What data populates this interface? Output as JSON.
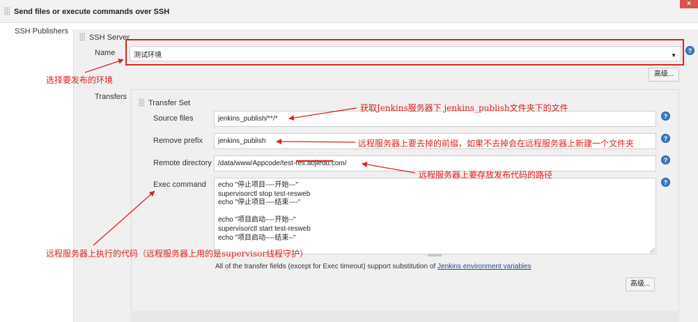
{
  "header": {
    "title": "Send files or execute commands over SSH",
    "close": "×"
  },
  "publishers": {
    "label": "SSH Publishers"
  },
  "server": {
    "section_title": "SSH Server",
    "name_label": "Name",
    "name_value": "测试环境",
    "advanced_button": "高级..."
  },
  "transfers": {
    "label": "Transfers",
    "set_title": "Transfer Set",
    "source_files_label": "Source files",
    "source_files_value": "jenkins_publish/**/*",
    "remove_prefix_label": "Remove prefix",
    "remove_prefix_value": "jenkins_publish",
    "remote_directory_label": "Remote directory",
    "remote_directory_value": "/data/www/Appcode/test-res.aojiedu.com/",
    "exec_command_label": "Exec command",
    "exec_command_value": "echo \"停止项目----开始---\"\nsupervisorctl stop test-resweb\necho \"停止项目----结束----\"\n\necho \"项目启动----开始--\"\nsupervisorctl start test-resweb\necho \"项目启动----结束--\"",
    "note_text": "All of the transfer fields (except for Exec timeout) support substitution of ",
    "note_link": "Jenkins environment variables",
    "advanced_button": "高级..."
  },
  "help_icon": "?",
  "annotations": {
    "env": "选择要发布的环境",
    "source": "获取Jenkins服务器下 jenkins_publish文件夹下的文件",
    "prefix": "远程服务器上要去掉的前缀，如果不去掉会在远程服务器上新建一个文件夹",
    "remote": "远程服务器上要存放发布代码的路径",
    "exec": "远程服务器上执行的代码（远程服务器上用的是supervisor线程守护）"
  },
  "colors": {
    "annotation": "#e02020",
    "help": "#3d78c2",
    "link": "#204a87"
  }
}
